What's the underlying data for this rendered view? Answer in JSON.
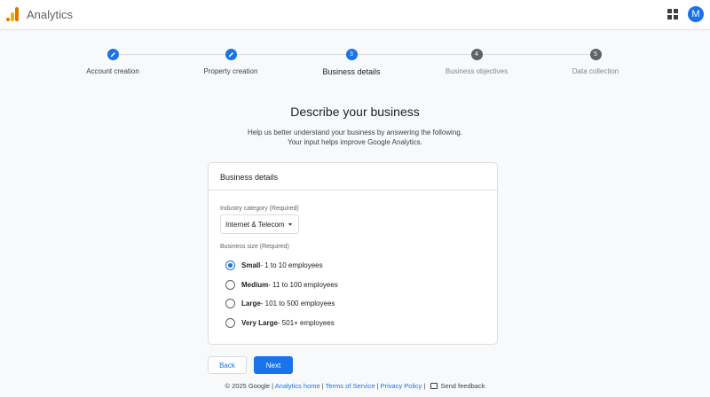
{
  "header": {
    "app_title": "Analytics",
    "avatar_initial": "M"
  },
  "stepper": {
    "steps": [
      {
        "number": "1",
        "label": "Account creation",
        "state": "completed"
      },
      {
        "number": "2",
        "label": "Property creation",
        "state": "completed"
      },
      {
        "number": "3",
        "label": "Business details",
        "state": "active"
      },
      {
        "number": "4",
        "label": "Business objectives",
        "state": "pending"
      },
      {
        "number": "5",
        "label": "Data collection",
        "state": "pending"
      }
    ]
  },
  "main": {
    "heading": "Describe your business",
    "subtext_line1": "Help us better understand your business by answering the following.",
    "subtext_line2": "Your input helps improve Google Analytics."
  },
  "card": {
    "title": "Business details",
    "industry_label": "Industry category (Required)",
    "industry_value": "Internet & Telecom",
    "size_label": "Business size (Required)",
    "size_options": [
      {
        "name": "Small",
        "detail": " - 1 to 10 employees",
        "checked": true
      },
      {
        "name": "Medium",
        "detail": " - 11 to 100 employees",
        "checked": false
      },
      {
        "name": "Large",
        "detail": " - 101 to 500 employees",
        "checked": false
      },
      {
        "name": "Very Large",
        "detail": " - 501+ employees",
        "checked": false
      }
    ]
  },
  "actions": {
    "back_label": "Back",
    "next_label": "Next"
  },
  "footer": {
    "copyright": "© 2025 Google",
    "separator": " | ",
    "analytics_home": "Analytics home",
    "terms": "Terms of Service",
    "privacy": "Privacy Policy",
    "feedback": "Send feedback"
  },
  "colors": {
    "accent": "#1a73e8",
    "pending_step": "#5f6368",
    "background": "#f8f9fa"
  }
}
